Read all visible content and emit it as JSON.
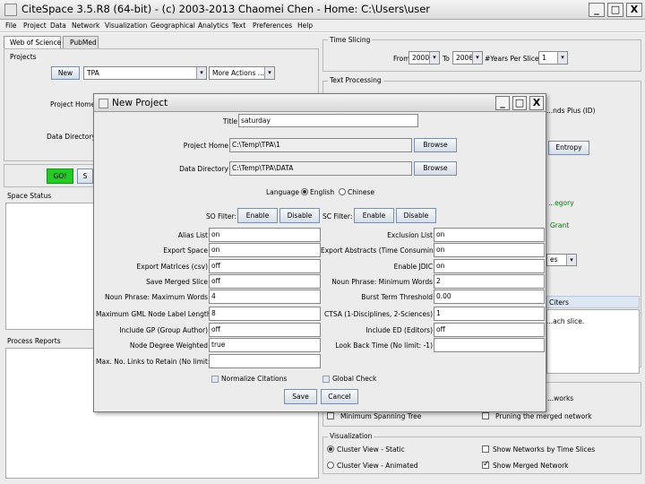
{
  "window": {
    "title": "CiteSpace 3.5.R8 (64-bit) - (c) 2003-2013 Chaomei Chen - Home: C:\\Users\\user",
    "min": "_",
    "max": "□",
    "close": "X"
  },
  "menu": [
    "File",
    "Project",
    "Data",
    "Network",
    "Visualization",
    "Geographical",
    "Analytics",
    "Text",
    "Preferences",
    "Help"
  ],
  "left": {
    "tabs": [
      "Web of Science",
      "PubMed"
    ],
    "projects_label": "Projects",
    "new_btn": "New",
    "project_value": "TPA",
    "more_actions": "More Actions ...",
    "project_home_label": "Project Home:",
    "data_directory_label": "Data Directory:",
    "go_btn": "GO!",
    "stop_btn": "S",
    "space_status": "Space Status",
    "process_reports": "Process Reports"
  },
  "right": {
    "time_slicing": "Time Slicing",
    "from_label": "From",
    "from_value": "2000",
    "to_label": "To",
    "to_value": "2006",
    "years_per_slice_label": "#Years Per Slice",
    "years_per_slice_value": "1",
    "text_processing": "Text Processing",
    "fragment_plus": "...nds Plus (ID)",
    "entropy_btn": "Entropy",
    "category_fragment": "...egory",
    "grant_fragment": "Grant",
    "combo_fragment": "es",
    "cites_fragment": "Citers",
    "slice_fragment": "...ach slice.",
    "networks_fragment": "...works",
    "minimum_spanning_tree": "Minimum Spanning Tree",
    "pruning_merged": "Pruning the merged network",
    "visualization": "Visualization",
    "cluster_static": "Cluster View - Static",
    "cluster_animated": "Cluster View - Animated",
    "show_time_slices": "Show Networks by Time Slices",
    "show_merged": "Show Merged Network"
  },
  "dialog": {
    "title": "New Project",
    "min": "_",
    "max": "□",
    "close": "X",
    "title_label": "Title",
    "title_value": "saturday",
    "project_home_label": "Project Home",
    "project_home_value": "C:\\Temp\\TPA\\1",
    "data_directory_label": "Data Directory",
    "data_directory_value": "C:\\Temp\\TPA\\DATA",
    "browse": "Browse",
    "language_label": "Language",
    "lang_english": "English",
    "lang_chinese": "Chinese",
    "so_filter": "SO Filter:",
    "sc_filter": "SC Filter:",
    "enable": "Enable",
    "disable": "Disable",
    "left_rows": [
      {
        "label": "Alias List",
        "value": "on"
      },
      {
        "label": "Export Space",
        "value": "on"
      },
      {
        "label": "Export Matrices (csv)",
        "value": "off"
      },
      {
        "label": "Save Merged Slice",
        "value": "off"
      },
      {
        "label": "Noun Phrase: Maximum Words",
        "value": "4"
      },
      {
        "label": "Maximum GML Node Label Length",
        "value": "8"
      },
      {
        "label": "Include GP (Group Author)",
        "value": "off"
      },
      {
        "label": "Node Degree Weighted",
        "value": "true"
      },
      {
        "label": "Max. No. Links to Retain (No limit: -1)",
        "value": ""
      }
    ],
    "right_rows": [
      {
        "label": "Exclusion List",
        "value": "on"
      },
      {
        "label": "Export Abstracts (Time Consuming)",
        "value": "on"
      },
      {
        "label": "Enable JDIC",
        "value": "on"
      },
      {
        "label": "Noun Phrase: Minimum Words",
        "value": "2"
      },
      {
        "label": "Burst Term Threshold",
        "value": "0.00"
      },
      {
        "label": "CTSA (1-Disciplines, 2-Sciences)",
        "value": "1"
      },
      {
        "label": "Include ED (Editors)",
        "value": "off"
      },
      {
        "label": "Look Back Time (No limit: -1)",
        "value": ""
      }
    ],
    "normalize_citations": "Normalize Citations",
    "global_check": "Global Check",
    "save": "Save",
    "cancel": "Cancel"
  },
  "colors": {
    "go": "#22cc22",
    "accent": "#7d8ea8"
  }
}
